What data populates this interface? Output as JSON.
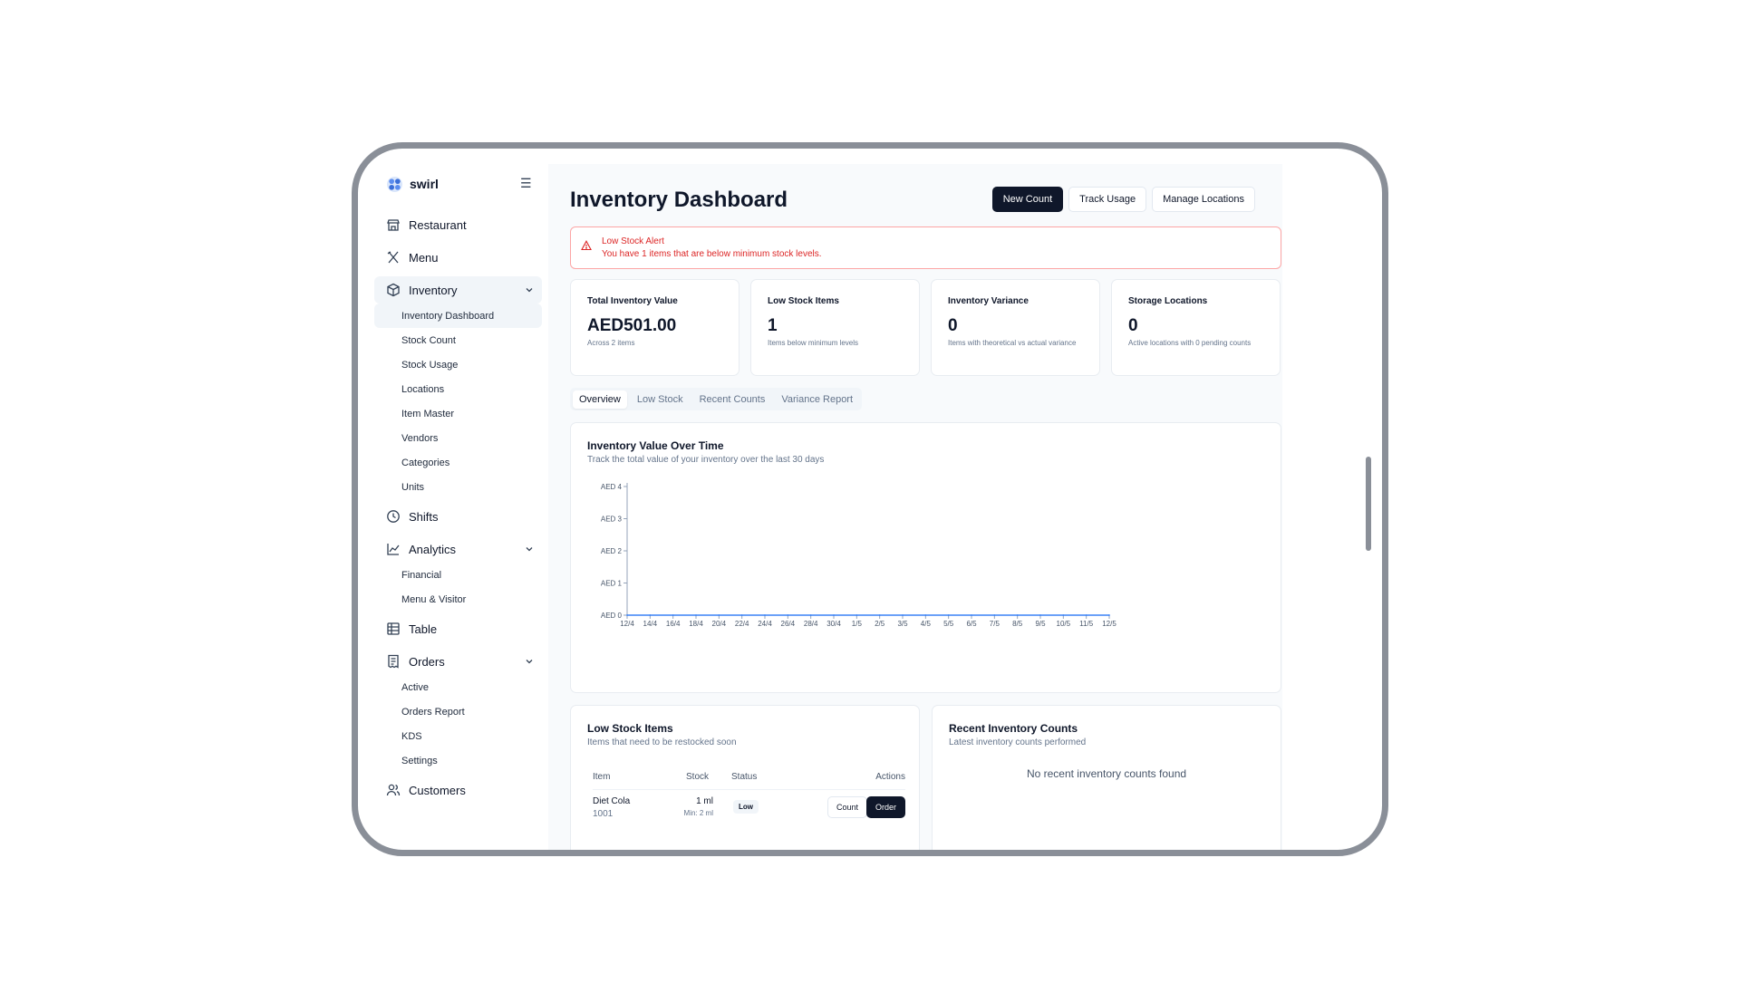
{
  "brand": {
    "name": "swirl",
    "menu_icon": "hamburger-icon"
  },
  "sidebar": {
    "items": [
      {
        "label": "Restaurant",
        "icon": "store-icon"
      },
      {
        "label": "Menu",
        "icon": "utensils-icon"
      },
      {
        "label": "Inventory",
        "icon": "package-icon",
        "expanded": true,
        "children": [
          "Inventory Dashboard",
          "Stock Count",
          "Stock Usage",
          "Locations",
          "Item Master",
          "Vendors",
          "Categories",
          "Units"
        ]
      },
      {
        "label": "Shifts",
        "icon": "clock-icon"
      },
      {
        "label": "Analytics",
        "icon": "line-chart-icon",
        "expanded": true,
        "children": [
          "Financial",
          "Menu & Visitor"
        ]
      },
      {
        "label": "Table",
        "icon": "grid-icon"
      },
      {
        "label": "Orders",
        "icon": "receipt-icon",
        "expanded": true,
        "children": [
          "Active",
          "Orders Report",
          "KDS",
          "Settings"
        ]
      },
      {
        "label": "Customers",
        "icon": "users-icon"
      }
    ]
  },
  "header": {
    "title": "Inventory Dashboard",
    "new_count": "New Count",
    "track_usage": "Track Usage",
    "manage_locations": "Manage Locations"
  },
  "alert": {
    "title": "Low Stock Alert",
    "text": "You have 1 items that are below minimum stock levels.",
    "color": "#dc2626"
  },
  "stats": [
    {
      "label": "Total Inventory Value",
      "value": "AED501.00",
      "sub": "Across 2 items"
    },
    {
      "label": "Low Stock Items",
      "value": "1",
      "sub": "Items below minimum levels"
    },
    {
      "label": "Inventory Variance",
      "value": "0",
      "sub": "Items with theoretical vs actual variance"
    },
    {
      "label": "Storage Locations",
      "value": "0",
      "sub": "Active locations with 0 pending counts"
    }
  ],
  "tabs": [
    "Overview",
    "Low Stock",
    "Recent Counts",
    "Variance Report"
  ],
  "chart_card": {
    "title": "Inventory Value Over Time",
    "subtitle": "Track the total value of your inventory over the last 30 days"
  },
  "chart_data": {
    "type": "line",
    "x": [
      "12/4",
      "14/4",
      "16/4",
      "18/4",
      "20/4",
      "22/4",
      "24/4",
      "26/4",
      "28/4",
      "30/4",
      "1/5",
      "2/5",
      "3/5",
      "4/5",
      "5/5",
      "6/5",
      "7/5",
      "8/5",
      "9/5",
      "10/5",
      "11/5",
      "12/5"
    ],
    "series": [
      {
        "values": [
          0,
          0,
          0,
          0,
          0,
          0,
          0,
          0,
          0,
          0,
          0,
          0,
          0,
          0,
          0,
          0,
          0,
          0,
          0,
          0,
          0,
          0
        ],
        "color": "#3b82f6"
      }
    ],
    "y_ticks": [
      "AED 0",
      "AED 1",
      "AED 2",
      "AED 3",
      "AED 4"
    ],
    "ylim": [
      0,
      4
    ],
    "xlabel": "",
    "ylabel": "",
    "grid": false
  },
  "low_stock": {
    "title": "Low Stock Items",
    "subtitle": "Items that need to be restocked soon",
    "columns": [
      "Item",
      "Stock",
      "Status",
      "Actions"
    ],
    "rows": [
      {
        "name": "Diet Cola",
        "code": "1001",
        "stock": "1 ml",
        "min": "Min: 2 ml",
        "status": "Low",
        "count_label": "Count",
        "order_label": "Order"
      }
    ]
  },
  "recent_counts": {
    "title": "Recent Inventory Counts",
    "subtitle": "Latest inventory counts performed",
    "empty": "No recent inventory counts found"
  }
}
